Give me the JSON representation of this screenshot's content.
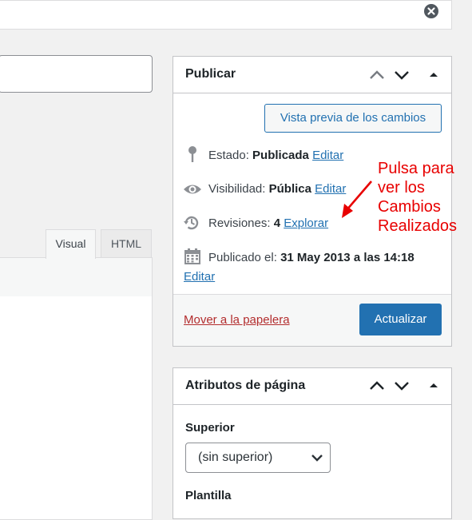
{
  "notice": {
    "dismiss_icon": "close-circle-icon"
  },
  "editor": {
    "tabs": [
      {
        "label": "Visual"
      },
      {
        "label": "HTML"
      }
    ]
  },
  "publish": {
    "title": "Publicar",
    "preview_label": "Vista previa de los cambios",
    "status": {
      "label": "Estado:",
      "value": "Publicada",
      "edit": "Editar",
      "icon": "pin-icon"
    },
    "visibility": {
      "label": "Visibilidad:",
      "value": "Pública",
      "edit": "Editar",
      "icon": "eye-icon"
    },
    "revisions": {
      "label": "Revisiones:",
      "value": "4",
      "link": "Explorar",
      "icon": "history-icon"
    },
    "published": {
      "label": "Publicado el:",
      "value": "31 May 2013 a las 14:18",
      "edit": "Editar",
      "icon": "calendar-icon"
    },
    "trash_label": "Mover a la papelera",
    "update_label": "Actualizar"
  },
  "annotation": {
    "lines": [
      "Pulsa para",
      "ver los",
      "Cambios",
      "Realizados"
    ],
    "color": "#e80000"
  },
  "attributes": {
    "title": "Atributos de página",
    "parent_label": "Superior",
    "parent_value": "(sin superior)",
    "template_label": "Plantilla"
  },
  "colors": {
    "accent": "#2271b1",
    "danger": "#b32d2e"
  }
}
